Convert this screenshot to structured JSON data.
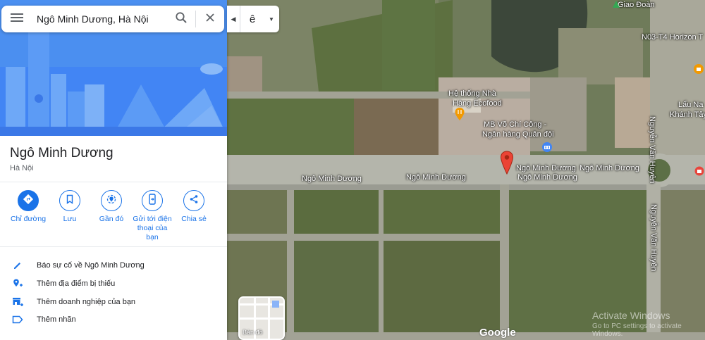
{
  "search": {
    "value": "Ngô Minh Dương, Hà Nội"
  },
  "language": {
    "value": "ê"
  },
  "place": {
    "title": "Ngô Minh Dương",
    "subtitle": "Hà Nội"
  },
  "actions": [
    {
      "label": "Chỉ đường",
      "icon": "directions-icon"
    },
    {
      "label": "Lưu",
      "icon": "bookmark-icon"
    },
    {
      "label": "Gần đó",
      "icon": "nearby-icon"
    },
    {
      "label": "Gửi tới điện thoại của bạn",
      "icon": "send-to-phone-icon"
    },
    {
      "label": "Chia sẻ",
      "icon": "share-icon"
    }
  ],
  "links": [
    {
      "label": "Báo sự cố về Ngô Minh Dương",
      "icon": "pencil-icon"
    },
    {
      "label": "Thêm địa điểm bị thiếu",
      "icon": "add-place-icon"
    },
    {
      "label": "Thêm doanh nghiệp của bạn",
      "icon": "add-business-icon"
    },
    {
      "label": "Thêm nhãn",
      "icon": "label-icon"
    }
  ],
  "map": {
    "labels": {
      "giao_doan": "Giao Đoàn",
      "n03": "N03-T4 Horizon T",
      "he_thong_1": "Hệ thống Nhà",
      "he_thong_2": "Hàng Ecofood",
      "mb_1": "MB Võ Chí Công -",
      "mb_2": "Ngân hàng Quân đội",
      "street_1": "Ngô Minh Dương",
      "street_2": "Ngô Minh Dương",
      "street_3": "Ngô Minh Dương",
      "street_4": "Ngô Minh Dương",
      "street_5": "Ngô Minh Dương",
      "nguyen_van_huyen_1": "Nguyễn Văn Huyên",
      "nguyen_van_huyen_2": "Nguyễn Văn Huyên",
      "lau_na": "Lẩu Na",
      "khanh_tay": "Khánh Tây"
    },
    "minimap_label": "Bản đồ",
    "google_logo": "Google",
    "activate_title": "Activate Windows",
    "activate_sub": "Go to PC settings to activate Windows."
  },
  "colors": {
    "accent": "#1a73e8",
    "pin": "#ea4335",
    "hero": "#4b8ff0"
  }
}
